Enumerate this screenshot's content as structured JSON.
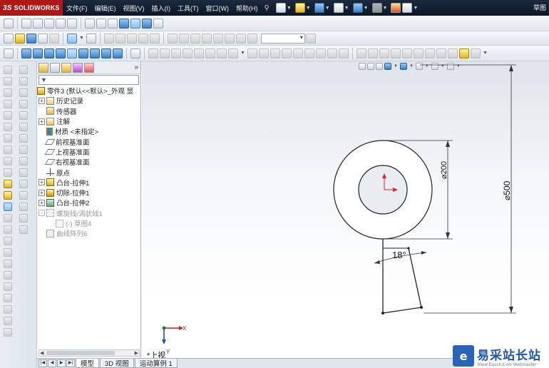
{
  "app": {
    "logo_text": "SOLIDWORKS",
    "logo_mark": "3S",
    "title_right": "草图"
  },
  "menu": [
    "文件(F)",
    "编辑(E)",
    "视图(V)",
    "插入(I)",
    "工具(T)",
    "窗口(W)",
    "帮助(H)"
  ],
  "feature_tree": {
    "root": "零件3 (默认<<默认>_外观 显",
    "items": [
      {
        "label": "历史记录",
        "expand": "+",
        "icon": "history-icon"
      },
      {
        "label": "传感器",
        "expand": "",
        "icon": "sensor-icon"
      },
      {
        "label": "注解",
        "expand": "+",
        "icon": "annotation-icon"
      },
      {
        "label": "材质 <未指定>",
        "expand": "",
        "icon": "material-icon"
      },
      {
        "label": "前视基准面",
        "expand": "",
        "icon": "plane-icon"
      },
      {
        "label": "上视基准面",
        "expand": "",
        "icon": "plane-icon"
      },
      {
        "label": "右视基准面",
        "expand": "",
        "icon": "plane-icon"
      },
      {
        "label": "原点",
        "expand": "",
        "icon": "origin-icon"
      },
      {
        "label": "凸台-拉伸1",
        "expand": "+",
        "icon": "boss-extrude-icon"
      },
      {
        "label": "切除-拉伸1",
        "expand": "+",
        "icon": "cut-extrude-icon"
      },
      {
        "label": "凸台-拉伸2",
        "expand": "+",
        "icon": "boss-extrude-icon"
      },
      {
        "label": "螺旋线/涡状线1",
        "expand": "-",
        "icon": "helix-icon",
        "dim": true
      },
      {
        "label": "(-) 草图4",
        "expand": "",
        "icon": "sketch-icon",
        "dim": true,
        "indent": true
      },
      {
        "label": "曲线阵列6",
        "expand": "",
        "icon": "curve-pattern-icon",
        "dim": true
      }
    ]
  },
  "viewport": {
    "view_label": "*上视",
    "dimensions": {
      "outer_height": "⌀500",
      "circle_diameter": "⌀200",
      "angle": "18°"
    },
    "triad": {
      "x_label": "X",
      "y_label": "Y"
    }
  },
  "bottom_tabs": [
    "模型",
    "3D 视图",
    "运动算例 1"
  ],
  "watermark": {
    "cn": "易采站长站",
    "en": "Www.Easck.Com  Webmaster"
  },
  "colors": {
    "logo_bg": "#b01818",
    "titlebar": "#14202f",
    "watermark_blue": "#1f56a8"
  }
}
